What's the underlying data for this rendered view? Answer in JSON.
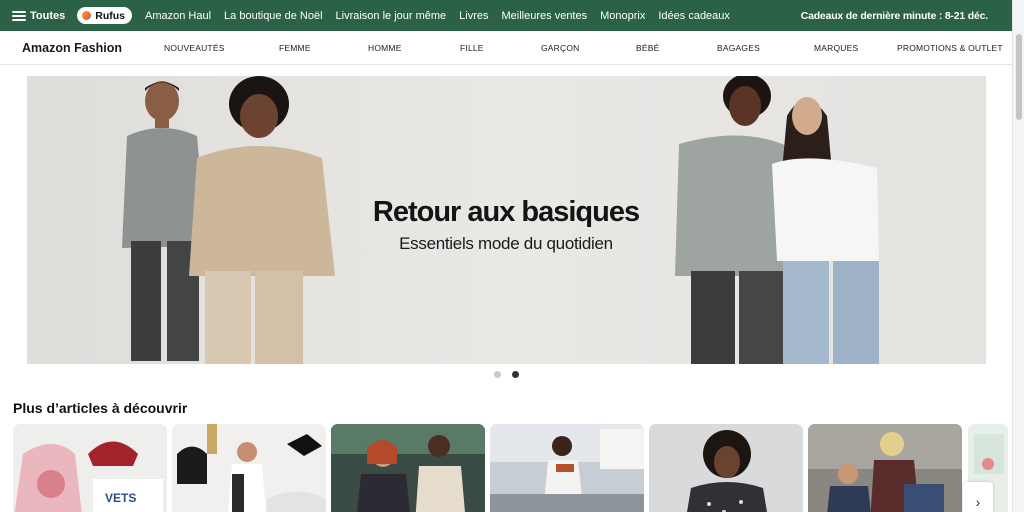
{
  "topnav": {
    "all_label": "Toutes",
    "rufus_label": "Rufus",
    "links": [
      "Amazon Haul",
      "La boutique de Noël",
      "Livraison le jour même",
      "Livres",
      "Meilleures ventes",
      "Monoprix",
      "Idées cadeaux"
    ],
    "promo": "Cadeaux de dernière minute : 8-21 déc."
  },
  "subnav": {
    "brand": "Amazon Fashion",
    "categories": [
      "NOUVEAUTÉS",
      "FEMME",
      "HOMME",
      "FILLE",
      "GARÇON",
      "BÉBÉ",
      "BAGAGES",
      "MARQUES",
      "PROMOTIONS & OUTLET"
    ]
  },
  "hero": {
    "title": "Retour aux basiques",
    "subtitle": "Essentiels mode du quotidien",
    "slide_count": 2,
    "active_slide": 2
  },
  "section": {
    "title": "Plus d’articles à découvrir"
  },
  "icons": {
    "menu": "hamburger-icon",
    "rufus": "rufus-sparkle-icon",
    "next": "chevron-right-icon"
  },
  "colors": {
    "topnav_bg": "#2b6147",
    "hero_bg": "#e4e3e0"
  }
}
